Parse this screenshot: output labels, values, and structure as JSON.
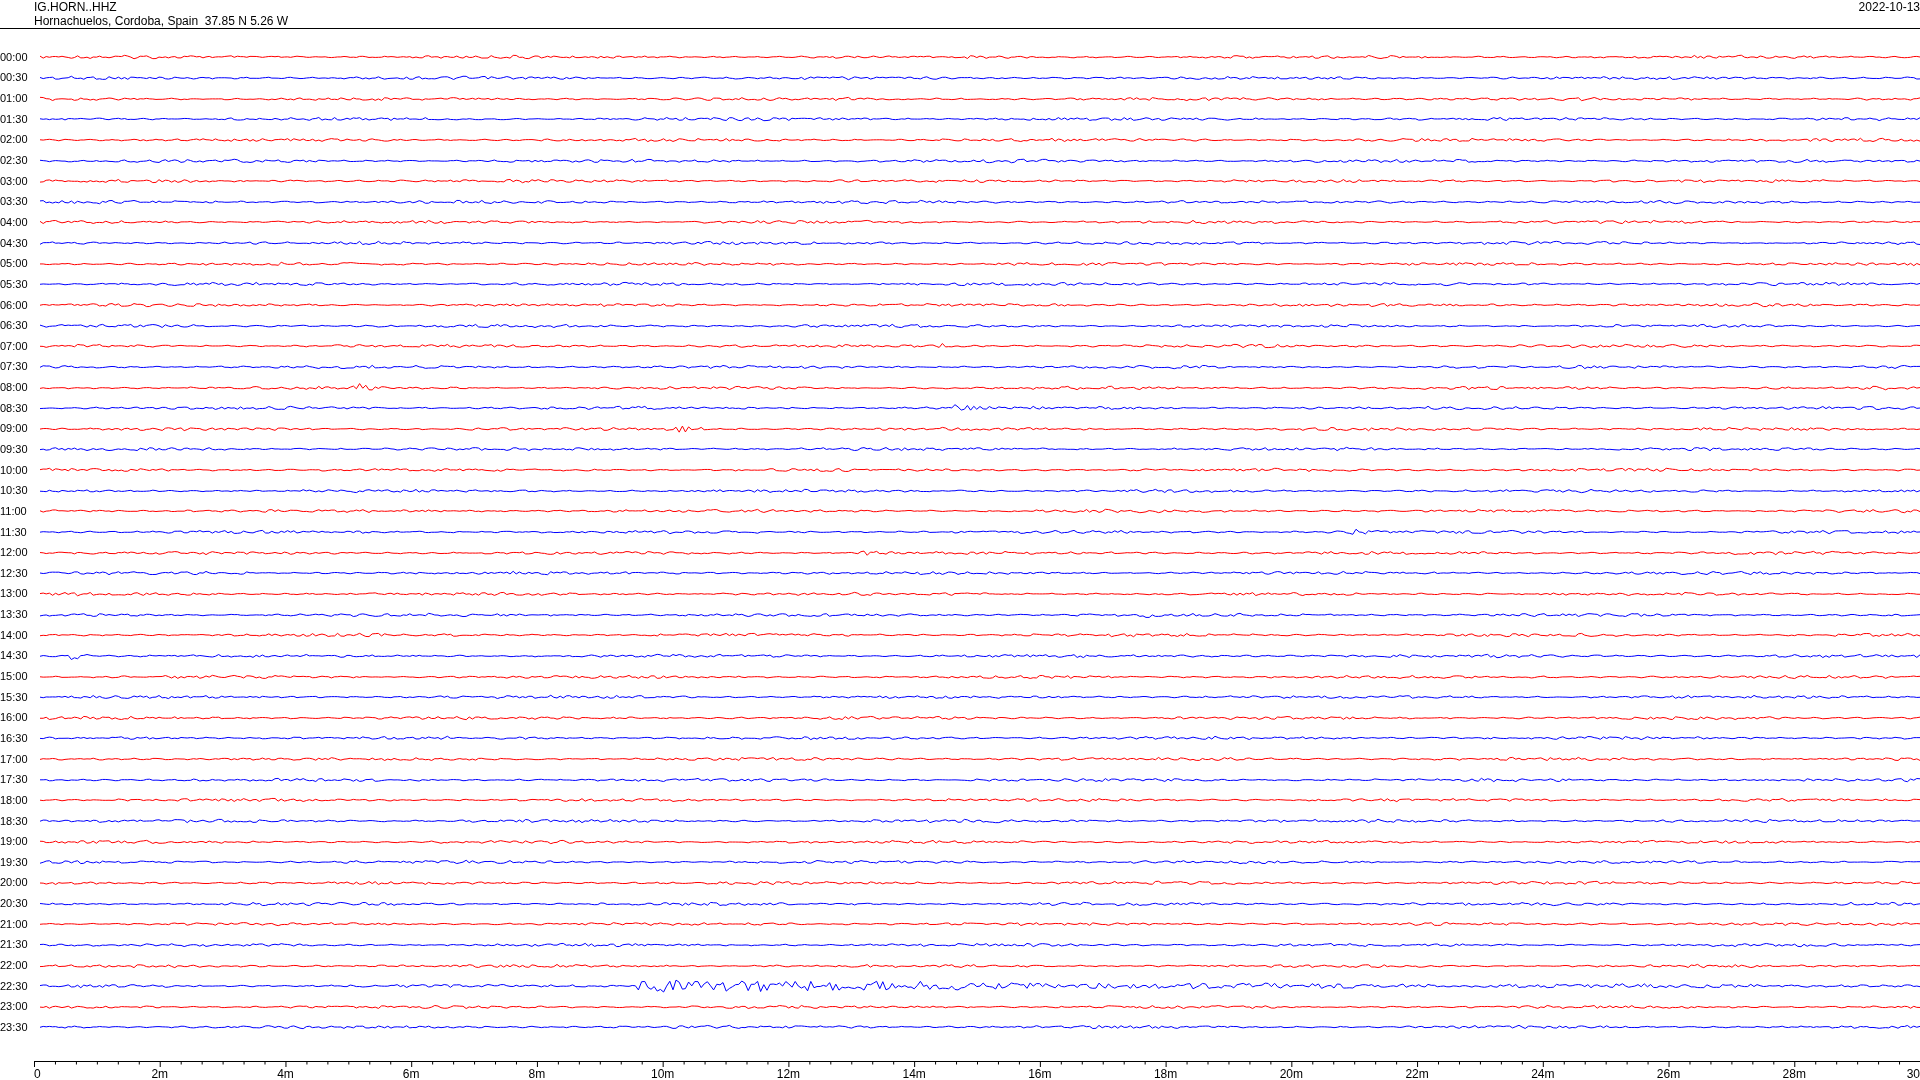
{
  "header": {
    "station": "IG.HORN..HHZ",
    "location": "Hornachuelos, Cordoba, Spain  37.85 N 5.26 W",
    "date": "2022-10-13"
  },
  "rows": [
    {
      "time": "00:00",
      "color": "#ff0000"
    },
    {
      "time": "00:30",
      "color": "#0000ff"
    },
    {
      "time": "01:00",
      "color": "#ff0000"
    },
    {
      "time": "01:30",
      "color": "#0000ff"
    },
    {
      "time": "02:00",
      "color": "#ff0000"
    },
    {
      "time": "02:30",
      "color": "#0000ff"
    },
    {
      "time": "03:00",
      "color": "#ff0000"
    },
    {
      "time": "03:30",
      "color": "#0000ff"
    },
    {
      "time": "04:00",
      "color": "#ff0000"
    },
    {
      "time": "04:30",
      "color": "#0000ff"
    },
    {
      "time": "05:00",
      "color": "#ff0000"
    },
    {
      "time": "05:30",
      "color": "#0000ff"
    },
    {
      "time": "06:00",
      "color": "#ff0000"
    },
    {
      "time": "06:30",
      "color": "#0000ff"
    },
    {
      "time": "07:00",
      "color": "#ff0000"
    },
    {
      "time": "07:30",
      "color": "#0000ff"
    },
    {
      "time": "08:00",
      "color": "#ff0000"
    },
    {
      "time": "08:30",
      "color": "#0000ff"
    },
    {
      "time": "09:00",
      "color": "#ff0000"
    },
    {
      "time": "09:30",
      "color": "#0000ff"
    },
    {
      "time": "10:00",
      "color": "#ff0000"
    },
    {
      "time": "10:30",
      "color": "#0000ff"
    },
    {
      "time": "11:00",
      "color": "#ff0000"
    },
    {
      "time": "11:30",
      "color": "#0000ff"
    },
    {
      "time": "12:00",
      "color": "#ff0000"
    },
    {
      "time": "12:30",
      "color": "#0000ff"
    },
    {
      "time": "13:00",
      "color": "#ff0000"
    },
    {
      "time": "13:30",
      "color": "#0000ff"
    },
    {
      "time": "14:00",
      "color": "#ff0000"
    },
    {
      "time": "14:30",
      "color": "#0000ff"
    },
    {
      "time": "15:00",
      "color": "#ff0000"
    },
    {
      "time": "15:30",
      "color": "#0000ff"
    },
    {
      "time": "16:00",
      "color": "#ff0000"
    },
    {
      "time": "16:30",
      "color": "#0000ff"
    },
    {
      "time": "17:00",
      "color": "#ff0000"
    },
    {
      "time": "17:30",
      "color": "#0000ff"
    },
    {
      "time": "18:00",
      "color": "#ff0000"
    },
    {
      "time": "18:30",
      "color": "#0000ff"
    },
    {
      "time": "19:00",
      "color": "#ff0000"
    },
    {
      "time": "19:30",
      "color": "#0000ff"
    },
    {
      "time": "20:00",
      "color": "#ff0000"
    },
    {
      "time": "20:30",
      "color": "#0000ff"
    },
    {
      "time": "21:00",
      "color": "#ff0000"
    },
    {
      "time": "21:30",
      "color": "#0000ff"
    },
    {
      "time": "22:00",
      "color": "#ff0000"
    },
    {
      "time": "22:30",
      "color": "#0000ff"
    },
    {
      "time": "23:00",
      "color": "#ff0000"
    },
    {
      "time": "23:30",
      "color": "#0000ff"
    }
  ],
  "x_axis": {
    "labels": [
      "0",
      "2m",
      "4m",
      "6m",
      "8m",
      "10m",
      "12m",
      "14m",
      "16m",
      "18m",
      "20m",
      "22m",
      "24m",
      "26m",
      "28m",
      "30"
    ]
  }
}
